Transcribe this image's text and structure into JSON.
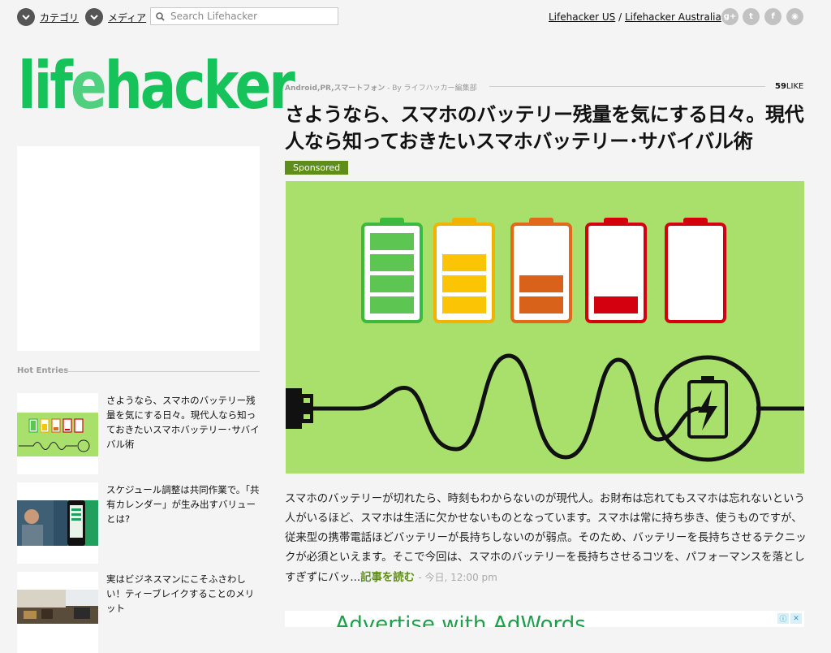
{
  "topbar": {
    "category_label": "カテゴリ",
    "media_label": "メディア",
    "search_placeholder": "Search Lifehacker",
    "links": [
      {
        "label": "Lifehacker US"
      },
      {
        "label": "Lifehacker Australia"
      }
    ],
    "link_separator": "/",
    "social": [
      {
        "name": "google-plus-icon",
        "glyph": "g+"
      },
      {
        "name": "twitter-icon",
        "glyph": "t"
      },
      {
        "name": "facebook-icon",
        "glyph": "f"
      },
      {
        "name": "rss-icon",
        "glyph": "◉"
      }
    ]
  },
  "logo": {
    "text_pre": "lif",
    "text_e": "e",
    "text_post": "hacker"
  },
  "sidebar": {
    "hot_entries_label": "Hot Entries",
    "entries": [
      {
        "title": "さようなら、スマホのバッテリー残量を気にする日々。現代人なら知っておきたいスマホバッテリー･サバイバル術"
      },
      {
        "title": "スケジュール調整は共同作業で。「共有カレンダー」が生み出すバリューとは?"
      },
      {
        "title": "実はビジネスマンにこそふさわしい！ティーブレイクすることのメリット"
      }
    ]
  },
  "article": {
    "categories": "Android,PR,スマートフォン",
    "byline": "- By ライフハッカー編集部",
    "likes_count": "59",
    "likes_label": "LIKE",
    "title": "さようなら、スマホのバッテリー残量を気にする日々。現代人なら知っておきたいスマホバッテリー･サバイバル術",
    "badge": "Sponsored",
    "excerpt": "スマホのバッテリーが切れたら、時刻もわからないのが現代人。お財布は忘れてもスマホは忘れないという人がいるほど、スマホは生活に欠かせないものとなっています。スマホは常に持ち歩き、使うものですが、従来型の携帯電話ほどバッテリーが長持ちしないのが弱点。そのため、バッテリーを長持ちさせるテクニックが必須といえます。そこで今回は、スマホのバッテリーを長持ちさせるコツを、パフォーマンスを落としすぎずにバッ...",
    "read_more": "記事を読む",
    "time": "- 今日, 12:00 pm"
  },
  "ad_bottom": {
    "text": "Advertise with AdWords"
  },
  "colors": {
    "brand_green": "#16c35a",
    "accent_green": "#5e8e1a",
    "hero_bg": "#a9e06c"
  }
}
